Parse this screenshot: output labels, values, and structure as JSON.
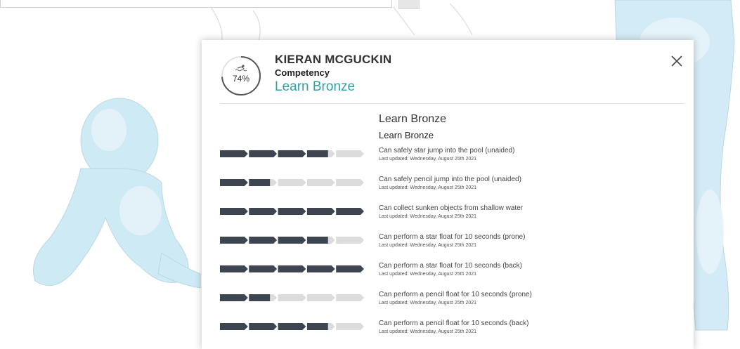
{
  "student": {
    "name": "KIERAN MCGUCKIN",
    "category": "Competency",
    "level": "Learn Bronze",
    "progress_percent_label": "74%",
    "progress_fraction": 0.74
  },
  "section": {
    "title": "Learn Bronze",
    "subtitle": "Learn Bronze"
  },
  "colors": {
    "accent": "#2aa2a6",
    "segment_filled": "#3d4650",
    "segment_empty": "#dcdcdc"
  },
  "icons": {
    "close": "close-icon",
    "swimmer": "swimmer-icon"
  },
  "segments_per_skill": 5,
  "skills": [
    {
      "text": "Can safely star jump into the pool (unaided)",
      "date": "Last updated: Wednesday, August 25th 2021",
      "progress": 0.75
    },
    {
      "text": "Can safely pencil jump into the pool (unaided)",
      "date": "Last updated: Wednesday, August 25th 2021",
      "progress": 0.35
    },
    {
      "text": "Can collect sunken objects from shallow water",
      "date": "Last updated: Wednesday, August 25th 2021",
      "progress": 1.0
    },
    {
      "text": "Can perform a star float for 10 seconds (prone)",
      "date": "Last updated: Wednesday, August 25th 2021",
      "progress": 0.75
    },
    {
      "text": "Can perform a star float for 10 seconds (back)",
      "date": "Last updated: Wednesday, August 25th 2021",
      "progress": 1.0
    },
    {
      "text": "Can perform a pencil float for 10 seconds (prone)",
      "date": "Last updated: Wednesday, August 25th 2021",
      "progress": 0.35
    },
    {
      "text": "Can perform a pencil float for 10 seconds (back)",
      "date": "Last updated: Wednesday, August 25th 2021",
      "progress": 0.75
    }
  ]
}
